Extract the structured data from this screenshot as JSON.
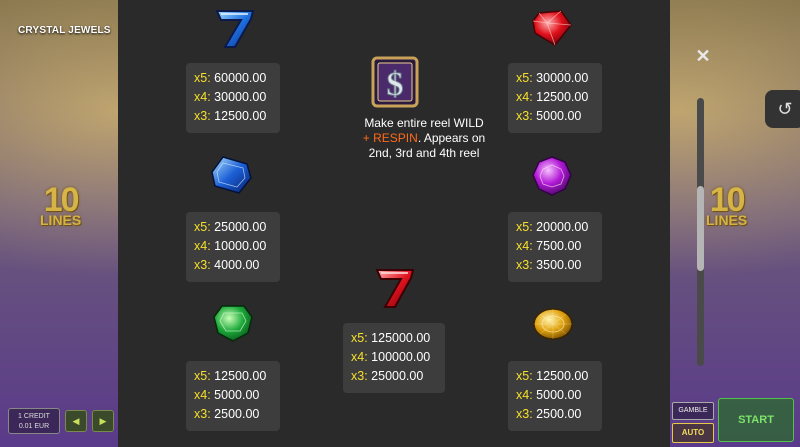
{
  "game": {
    "title": "CRYSTAL JEWELS",
    "lines_number": "10",
    "lines_label": "LINES",
    "credit_line1": "1 CREDIT",
    "credit_line2": "0.01 EUR"
  },
  "controls": {
    "close_symbol": "✕",
    "history_symbol": "↺",
    "gamble_label": "GAMBLE",
    "auto_label": "AUTO",
    "start_label": "START",
    "prev_arrow": "◀",
    "next_arrow": "▶"
  },
  "paytable": {
    "blue_seven": {
      "icon": "blue-seven-icon",
      "rows": [
        {
          "mult": "x5:",
          "value": "60000.00"
        },
        {
          "mult": "x4:",
          "value": "30000.00"
        },
        {
          "mult": "x3:",
          "value": "12500.00"
        }
      ]
    },
    "red_gem": {
      "icon": "red-gem-icon",
      "rows": [
        {
          "mult": "x5:",
          "value": "30000.00"
        },
        {
          "mult": "x4:",
          "value": "12500.00"
        },
        {
          "mult": "x3:",
          "value": "5000.00"
        }
      ]
    },
    "wild": {
      "icon": "dollar-wild-icon",
      "text_line1": "Make entire reel WILD",
      "text_respin": "+ RESPIN",
      "text_line2": ". Appears on",
      "text_line3": "2nd, 3rd and 4th reel"
    },
    "blue_gem": {
      "icon": "blue-gem-icon",
      "rows": [
        {
          "mult": "x5:",
          "value": "25000.00"
        },
        {
          "mult": "x4:",
          "value": "10000.00"
        },
        {
          "mult": "x3:",
          "value": "4000.00"
        }
      ]
    },
    "purple_gem": {
      "icon": "purple-gem-icon",
      "rows": [
        {
          "mult": "x5:",
          "value": "20000.00"
        },
        {
          "mult": "x4:",
          "value": "7500.00"
        },
        {
          "mult": "x3:",
          "value": "3500.00"
        }
      ]
    },
    "red_seven": {
      "icon": "red-seven-icon",
      "rows": [
        {
          "mult": "x5:",
          "value": "125000.00"
        },
        {
          "mult": "x4:",
          "value": "100000.00"
        },
        {
          "mult": "x3:",
          "value": "25000.00"
        }
      ]
    },
    "green_gem": {
      "icon": "green-gem-icon",
      "rows": [
        {
          "mult": "x5:",
          "value": "12500.00"
        },
        {
          "mult": "x4:",
          "value": "5000.00"
        },
        {
          "mult": "x3:",
          "value": "2500.00"
        }
      ]
    },
    "yellow_gem": {
      "icon": "yellow-gem-icon",
      "rows": [
        {
          "mult": "x5:",
          "value": "12500.00"
        },
        {
          "mult": "x4:",
          "value": "5000.00"
        },
        {
          "mult": "x3:",
          "value": "2500.00"
        }
      ]
    }
  },
  "colors": {
    "multiplier": "#f6e02a",
    "respin": "#ff6a1a",
    "panel": "#2a2a2a",
    "card": "#3d3d3d"
  }
}
